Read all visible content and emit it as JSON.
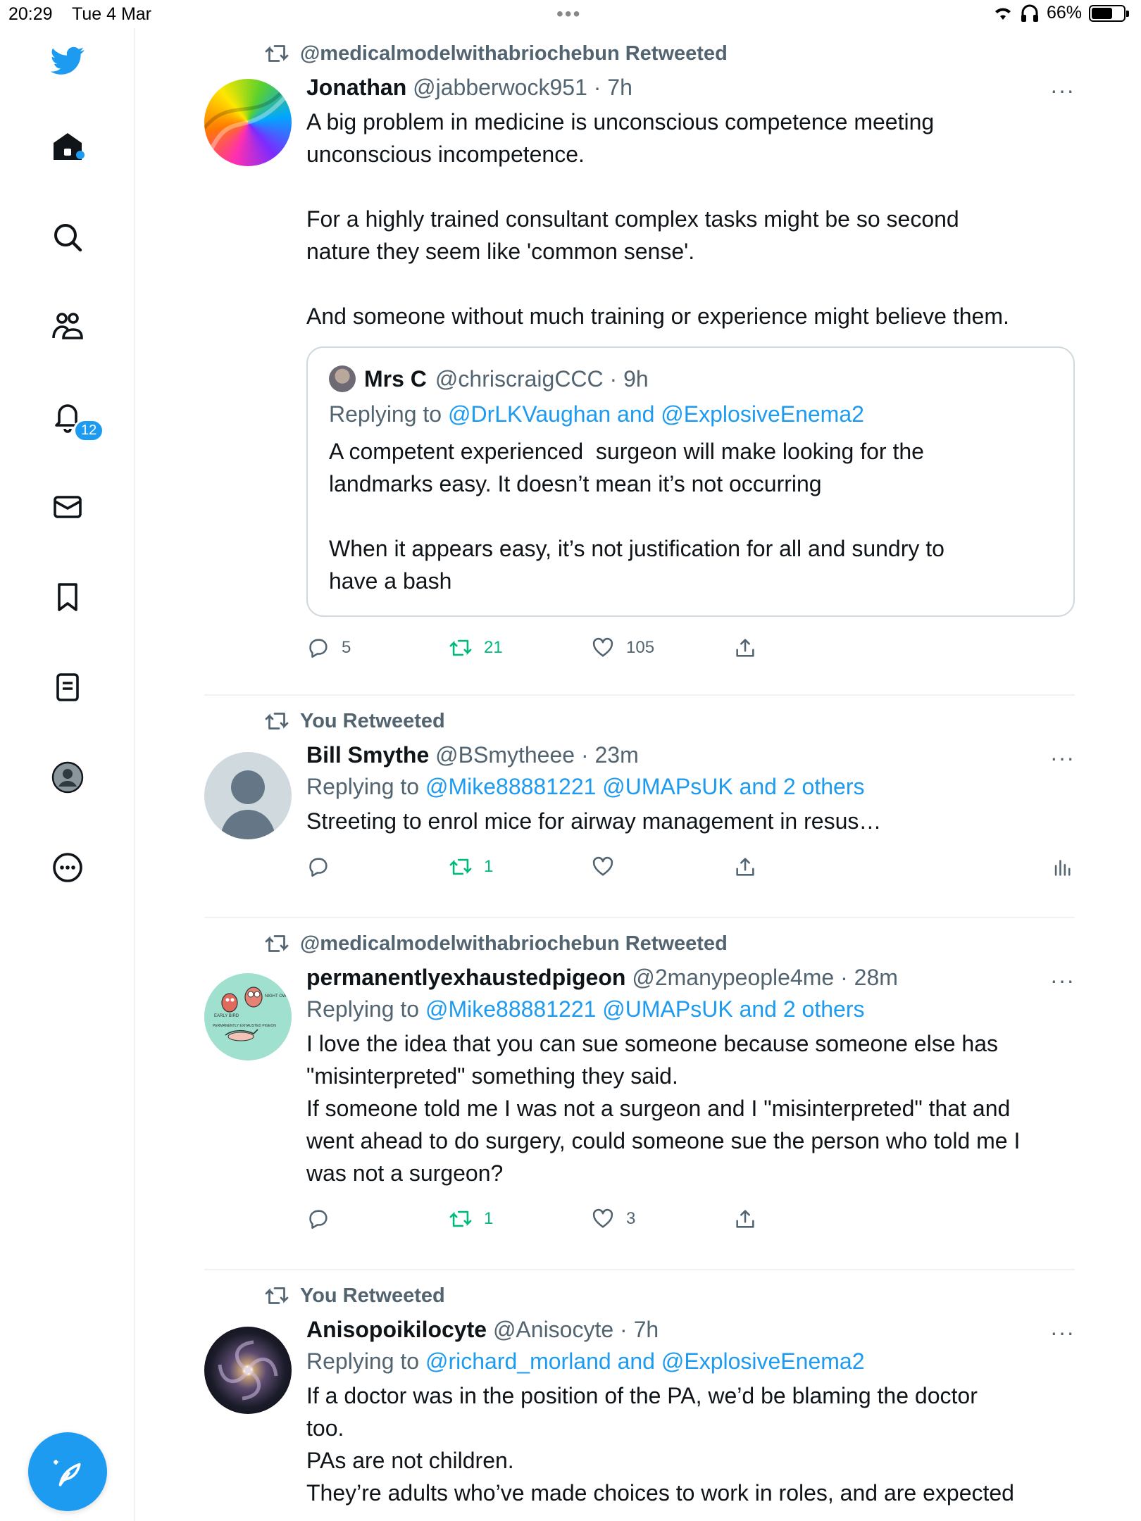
{
  "status_bar": {
    "time": "20:29",
    "date": "Tue 4 Mar",
    "battery": "66%",
    "battery_level": 0.66
  },
  "sidebar": {
    "notifications_badge": "12"
  },
  "tweets": [
    {
      "retweeted_by": "@medicalmodelwithabriochebun Retweeted",
      "name": "Jonathan",
      "handle": "@jabberwock951 · 7h",
      "more": "···",
      "body": "A big problem in medicine is unconscious competence meeting\nunconscious incompetence.\n\nFor a highly trained consultant complex tasks might be so second\nnature they seem like 'common sense'.\n\nAnd someone without much training or experience might believe them.",
      "quote": {
        "name": "Mrs C",
        "handle": "@chriscraigCCC · 9h",
        "replying_prefix": "Replying to",
        "replying_to": "@DrLKVaughan and @ExplosiveEnema2",
        "body": "A competent experienced  surgeon will make looking for the\nlandmarks easy. It doesn’t mean it’s not occurring\n\nWhen it appears easy, it’s not justification for all and sundry to\nhave a bash"
      },
      "replies": "5",
      "retweets": "21",
      "likes": "105"
    },
    {
      "retweeted_by": "You Retweeted",
      "name": "Bill Smythe",
      "handle": "@BSmytheee · 23m",
      "more": "···",
      "replying_prefix": "Replying to",
      "replying_to": "@Mike88881221 @UMAPsUK and 2 others",
      "body": "Streeting to enrol mice for airway management in resus…",
      "replies": "",
      "retweets": "1",
      "likes": ""
    },
    {
      "retweeted_by": "@medicalmodelwithabriochebun Retweeted",
      "name": "permanentlyexhaustedpigeon",
      "handle": "@2manypeople4me · 28m",
      "more": "···",
      "replying_prefix": "Replying to",
      "replying_to": "@Mike88881221 @UMAPsUK and 2 others",
      "body": "I love the idea that you can sue someone because someone else has\n\"misinterpreted\" something they said.\nIf someone told me I was not a surgeon and I \"misinterpreted\" that and\nwent ahead to do surgery, could someone sue the person who told me I\nwas not a surgeon?",
      "avatar_text": {
        "early": "EARLY BIRD",
        "night": "NIGHT OWL",
        "pigeon": "PERMANENTLY EXHAUSTED PIGEON"
      },
      "replies": "",
      "retweets": "1",
      "likes": "3"
    },
    {
      "retweeted_by": "You Retweeted",
      "name": "Anisopoikilocyte",
      "handle": "@Anisocyte · 7h",
      "more": "···",
      "replying_prefix": "Replying to",
      "replying_to": "@richard_morland and @ExplosiveEnema2",
      "body": "If a doctor was in the position of the PA, we’d be blaming the doctor\ntoo.\nPAs are not children.\nThey’re adults who’ve made choices to work in roles, and are expected"
    }
  ],
  "colors": {
    "accent": "#1d9bf0",
    "retweet_green": "#00ba7c",
    "muted": "#536471",
    "border": "#eff3f4"
  }
}
